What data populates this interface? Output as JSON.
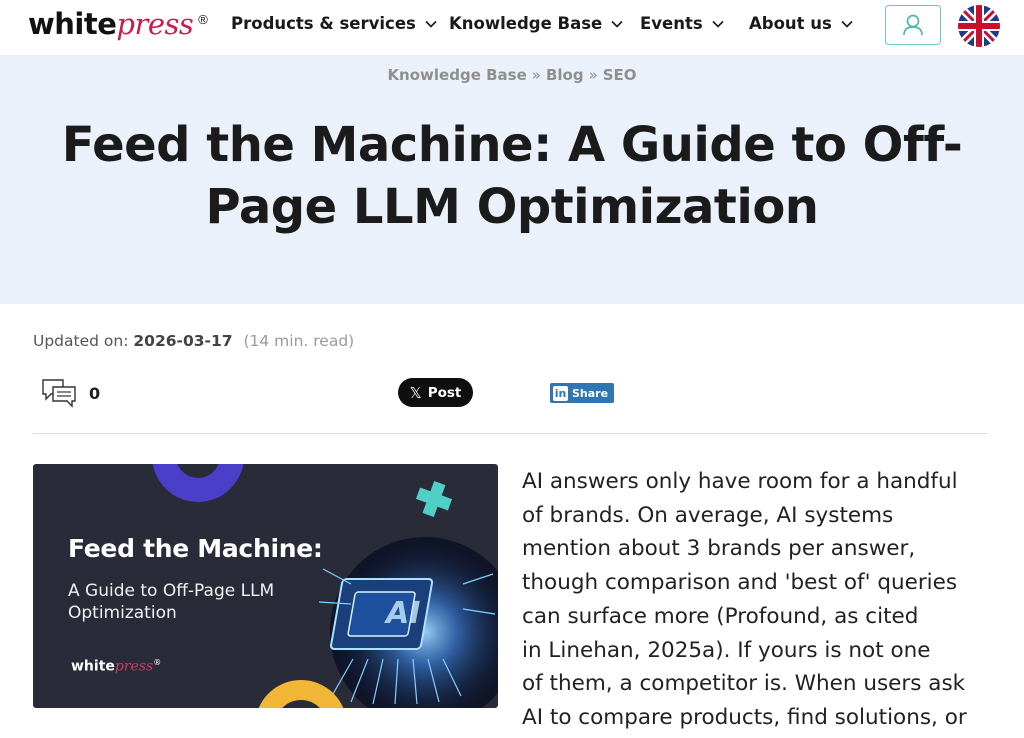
{
  "header": {
    "logo_white": "white",
    "logo_press": "press",
    "logo_reg": "®",
    "nav": [
      {
        "label": "Products & services"
      },
      {
        "label": "Knowledge Base"
      },
      {
        "label": "Events"
      },
      {
        "label": "About us"
      }
    ],
    "user_icon": "user-icon",
    "language_flag": "uk-flag-icon"
  },
  "breadcrumb": {
    "items": [
      "Knowledge Base",
      "Blog",
      "SEO"
    ],
    "separator": "»"
  },
  "article": {
    "title": "Feed the Machine: A Guide to Off-Page LLM Optimization",
    "updated_label": "Updated on:",
    "updated_date": "2026-03-17",
    "read_time": "(14 min. read)",
    "comment_count": "0",
    "x_post_label": "Post",
    "linkedin_share_label": "Share",
    "linkedin_in": "in",
    "body_lines": [
      "AI answers only have room for a handful",
      "of brands. On average, AI systems",
      "mention about 3 brands per answer,",
      "though comparison and 'best of' queries",
      "can surface more (Profound, as cited",
      "in Linehan, 2025a). If yours is not one",
      "of them, a competitor is. When users ask",
      "AI to compare products, find solutions, or"
    ]
  },
  "featured_image": {
    "title": "Feed the Machine:",
    "subtitle": "A Guide to Off-Page LLM Optimization",
    "logo_white": "white",
    "logo_press": "press",
    "logo_reg": "®",
    "chip_text": "AI"
  },
  "colors": {
    "brand_red": "#c81c4f",
    "hero_bg": "#ebf1fb",
    "teal": "#6ec9c5",
    "linkedin": "#2f76b3",
    "image_bg": "#2a2b38"
  }
}
